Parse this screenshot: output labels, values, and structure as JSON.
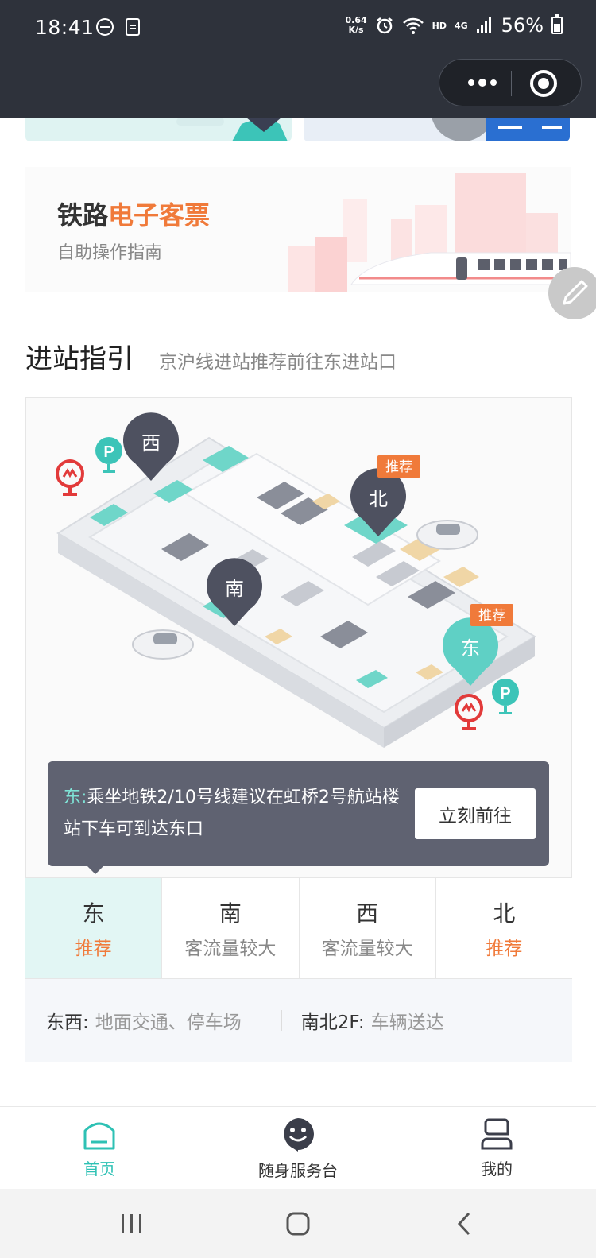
{
  "status_bar": {
    "time": "18:41",
    "net_speed_top": "0.64",
    "net_speed_unit": "K/s",
    "hd": "HD",
    "network": "4G",
    "battery": "56%"
  },
  "rail_banner": {
    "title_main": "铁路",
    "title_accent": "电子客票",
    "subtitle": "自助操作指南"
  },
  "section": {
    "title": "进站指引",
    "subtitle": "京沪线进站推荐前往东进站口"
  },
  "map": {
    "pins": {
      "west": "西",
      "north": "北",
      "south": "南",
      "east": "东"
    },
    "recommend_tag": "推荐",
    "parking_label": "P"
  },
  "tip": {
    "direction": "东:",
    "text": "乘坐地铁2/10号线建议在虹桥2号航站楼站下车可到达东口",
    "button": "立刻前往"
  },
  "tabs": [
    {
      "name": "东",
      "note": "推荐",
      "recommended": true,
      "active": true
    },
    {
      "name": "南",
      "note": "客流量较大",
      "recommended": false,
      "active": false
    },
    {
      "name": "西",
      "note": "客流量较大",
      "recommended": false,
      "active": false
    },
    {
      "name": "北",
      "note": "推荐",
      "recommended": true,
      "active": false
    }
  ],
  "traffic": {
    "ew_label": "东西:",
    "ew_value": "地面交通、停车场",
    "ns_label": "南北2F:",
    "ns_value": "车辆送达"
  },
  "bottom_nav": {
    "home": "首页",
    "service": "随身服务台",
    "mine": "我的"
  },
  "colors": {
    "accent": "#2ec1b4",
    "orange": "#f07a3a",
    "pin": "#4e5160"
  }
}
